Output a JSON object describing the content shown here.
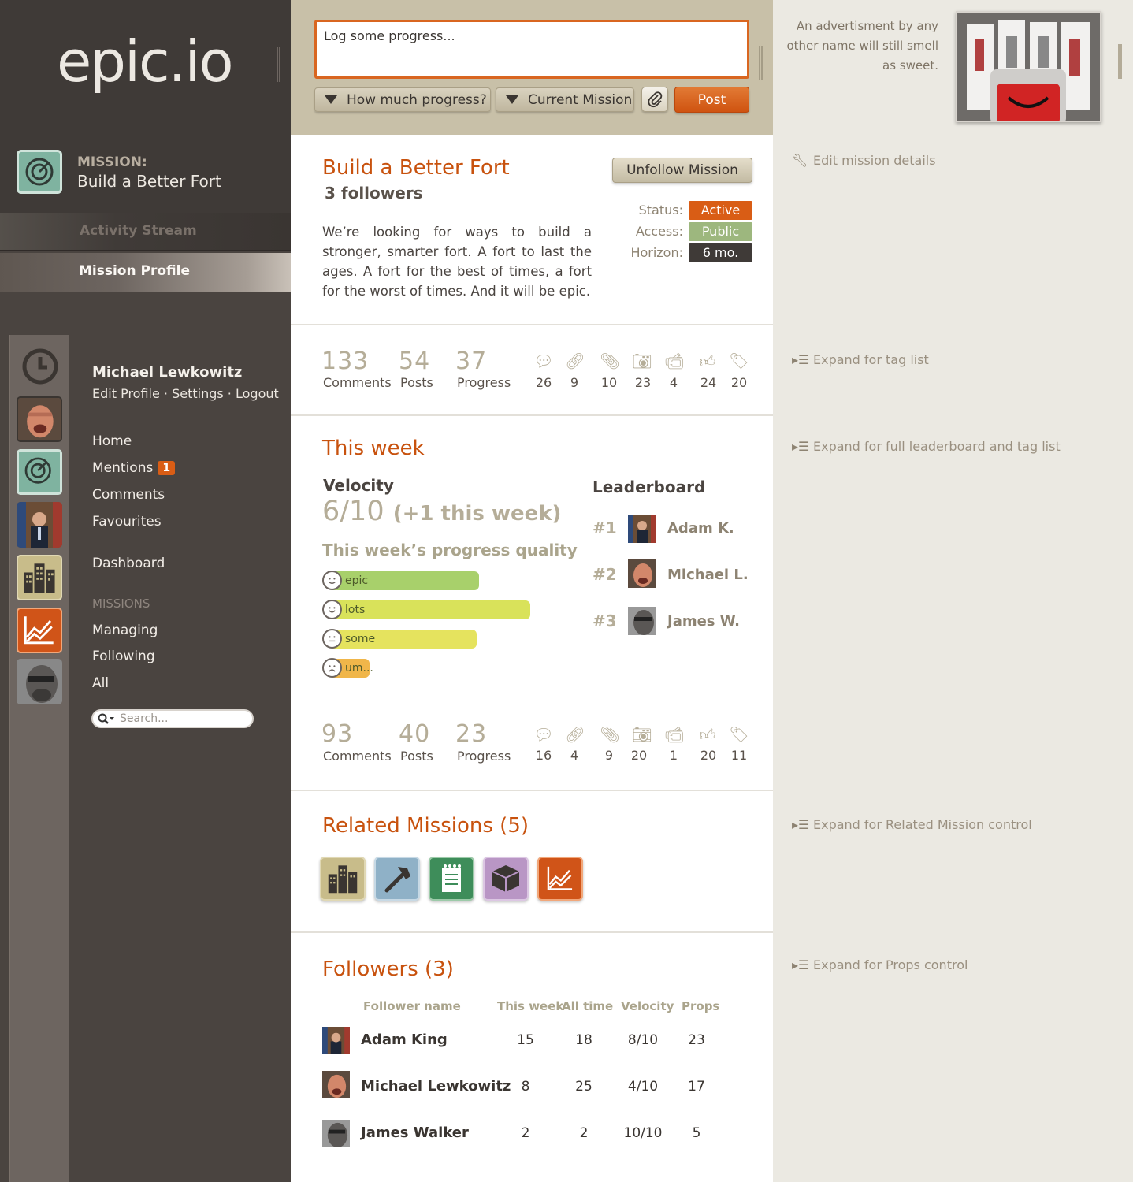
{
  "brand": {
    "logo": "epic.io"
  },
  "mission_header": {
    "label": "MISSION:",
    "name": "Build a Better Fort"
  },
  "nav": {
    "activity_stream": "Activity Stream",
    "mission_profile": "Mission Profile"
  },
  "user": {
    "name": "Michael Lewkowitz",
    "edit_profile": "Edit Profile",
    "settings": "Settings",
    "logout": "Logout",
    "sep": " · "
  },
  "menu": {
    "home": "Home",
    "mentions": "Mentions",
    "mentions_count": "1",
    "comments": "Comments",
    "favourites": "Favourites",
    "dashboard": "Dashboard",
    "missions_heading": "MISSIONS",
    "managing": "Managing",
    "following": "Following",
    "all": "All"
  },
  "search": {
    "placeholder": "Search..."
  },
  "composer": {
    "placeholder": "Log some progress...",
    "progress_dropdown": "How much progress?",
    "mission_dropdown": "Current Mission",
    "post_button": "Post"
  },
  "ad": {
    "text": "An advertisment by any other name will still smell as sweet."
  },
  "mission": {
    "title": "Build a Better Fort",
    "followers": "3 followers",
    "description": "We’re looking for ways to build a stronger, smarter fort. A fort to last the ages. A fort for the best of times, a fort for the worst of times. And it will be epic.",
    "unfollow_button": "Unfollow Mission",
    "status_label": "Status:",
    "status_value": "Active",
    "access_label": "Access:",
    "access_value": "Public",
    "horizon_label": "Horizon:",
    "horizon_value": "6 mo."
  },
  "all_time_stats": {
    "comments": "133",
    "comments_label": "Comments",
    "posts": "54",
    "posts_label": "Posts",
    "progress": "37",
    "progress_label": "Progress",
    "icons": [
      "26",
      "9",
      "10",
      "23",
      "4",
      "24",
      "20"
    ]
  },
  "this_week": {
    "title": "This week",
    "velocity_label": "Velocity",
    "velocity_value": "6/10",
    "velocity_delta": "(+1 this week)",
    "quality_heading": "This week’s progress quality",
    "quality": [
      {
        "label": "epic",
        "level": 0.55,
        "color": "#a8d06b"
      },
      {
        "label": "lots",
        "level": 0.74,
        "color": "#d9e25a"
      },
      {
        "label": "some",
        "level": 0.54,
        "color": "#e5e35e"
      },
      {
        "label": "um...",
        "level": 0.14,
        "color": "#f0b64a"
      }
    ],
    "leaderboard_heading": "Leaderboard",
    "leaderboard": [
      {
        "rank": "#1",
        "name": "Adam K."
      },
      {
        "rank": "#2",
        "name": "Michael L."
      },
      {
        "rank": "#3",
        "name": "James W."
      }
    ],
    "stats": {
      "comments": "93",
      "comments_label": "Comments",
      "posts": "40",
      "posts_label": "Posts",
      "progress": "23",
      "progress_label": "Progress",
      "icons": [
        "16",
        "4",
        "9",
        "20",
        "1",
        "20",
        "11"
      ]
    }
  },
  "related": {
    "title": "Related Missions (5)"
  },
  "followers_table": {
    "title": "Followers (3)",
    "headers": [
      "Follower name",
      "This week",
      "All time",
      "Velocity",
      "Props"
    ],
    "rows": [
      {
        "name": "Adam King",
        "this_week": "15",
        "all_time": "18",
        "velocity": "8/10",
        "props": "23"
      },
      {
        "name": "Michael Lewkowitz",
        "this_week": "8",
        "all_time": "25",
        "velocity": "4/10",
        "props": "17"
      },
      {
        "name": "James Walker",
        "this_week": "2",
        "all_time": "2",
        "velocity": "10/10",
        "props": "5"
      }
    ]
  },
  "right_panel": {
    "edit_details": "Edit mission details",
    "expand_tags": "Expand for tag list",
    "expand_leaderboard": "Expand for full leaderboard and tag list",
    "expand_related": "Expand for Related Mission control",
    "expand_props": "Expand for Props control"
  },
  "colors": {
    "accent": "#c8520e",
    "status_active": "#d95d15",
    "access_public": "#9db77e",
    "horizon": "#3f3a37"
  }
}
